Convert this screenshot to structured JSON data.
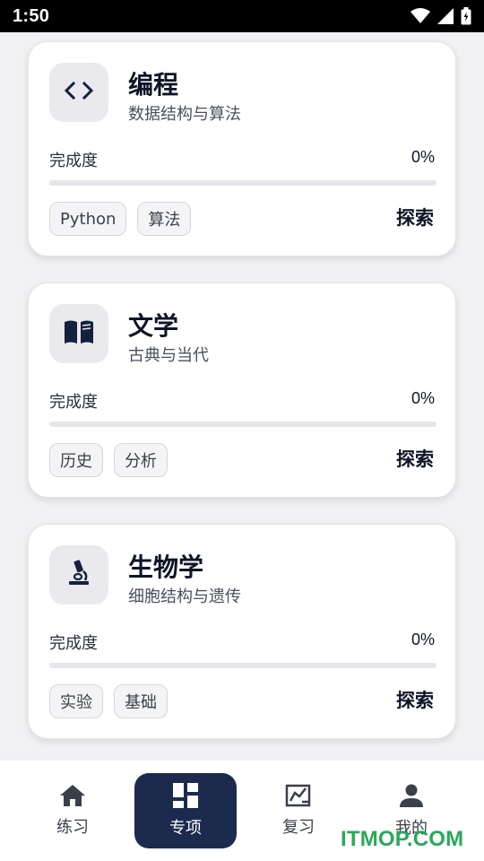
{
  "status_bar": {
    "time": "1:50"
  },
  "cards": [
    {
      "icon": "code-icon",
      "title": "编程",
      "subtitle": "数据结构与算法",
      "progress_label": "完成度",
      "progress_value": "0%",
      "progress": 0,
      "tags": [
        "Python",
        "算法"
      ],
      "action": "探索"
    },
    {
      "icon": "book-icon",
      "title": "文学",
      "subtitle": "古典与当代",
      "progress_label": "完成度",
      "progress_value": "0%",
      "progress": 0,
      "tags": [
        "历史",
        "分析"
      ],
      "action": "探索"
    },
    {
      "icon": "microscope-icon",
      "title": "生物学",
      "subtitle": "细胞结构与遗传",
      "progress_label": "完成度",
      "progress_value": "0%",
      "progress": 0,
      "tags": [
        "实验",
        "基础"
      ],
      "action": "探索"
    }
  ],
  "bottom_nav": {
    "items": [
      {
        "icon": "home-icon",
        "label": "练习",
        "active": false
      },
      {
        "icon": "dashboard-icon",
        "label": "专项",
        "active": true
      },
      {
        "icon": "review-icon",
        "label": "复习",
        "active": false
      },
      {
        "icon": "person-icon",
        "label": "我的",
        "active": false
      }
    ]
  },
  "watermark": "ITMOP.COM",
  "colors": {
    "accent": "#1c2b4d",
    "watermark": "#2aa85a"
  }
}
